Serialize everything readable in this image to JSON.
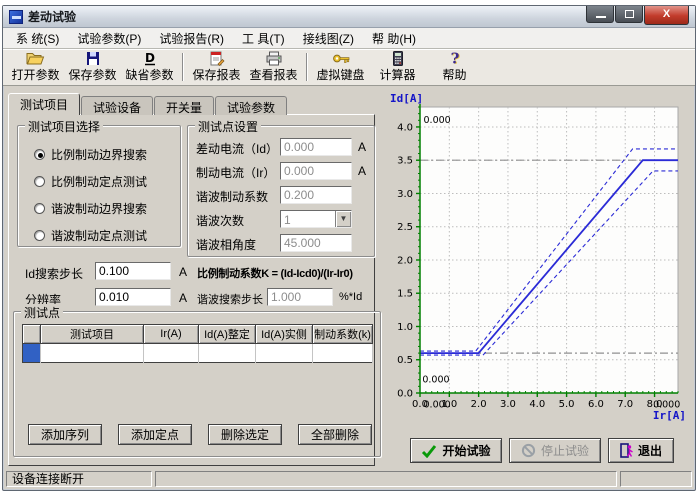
{
  "window": {
    "title": "差动试验",
    "controls": [
      {
        "name": "minimize-button",
        "icon": "minimize-icon"
      },
      {
        "name": "maximize-button",
        "icon": "maximize-icon"
      },
      {
        "name": "close-button",
        "icon": "close-icon"
      }
    ]
  },
  "menu": {
    "items": [
      {
        "label": "系 统(S)"
      },
      {
        "label": "试验参数(P)"
      },
      {
        "label": "试验报告(R)"
      },
      {
        "label": "工 具(T)"
      },
      {
        "label": "接线图(Z)"
      },
      {
        "label": "帮 助(H)"
      }
    ]
  },
  "toolbar": {
    "buttons": [
      {
        "label": "打开参数",
        "icon": "open-folder-icon"
      },
      {
        "label": "保存参数",
        "icon": "save-icon"
      },
      {
        "label": "缺省参数",
        "icon": "default-params-icon"
      },
      {
        "label": "保存报表",
        "icon": "save-report-icon"
      },
      {
        "label": "查看报表",
        "icon": "print-report-icon"
      },
      {
        "label": "虚拟键盘",
        "icon": "virtual-keyboard-icon"
      },
      {
        "label": "计算器",
        "icon": "calculator-icon"
      },
      {
        "label": "帮助",
        "icon": "help-icon"
      }
    ]
  },
  "tabs": [
    {
      "label": "测试项目",
      "active": true
    },
    {
      "label": "试验设备",
      "active": false
    },
    {
      "label": "开关量",
      "active": false
    },
    {
      "label": "试验参数",
      "active": false
    }
  ],
  "test_select": {
    "title": "测试项目选择",
    "options": [
      {
        "label": "比例制动边界搜索",
        "selected": true
      },
      {
        "label": "比例制动定点测试",
        "selected": false
      },
      {
        "label": "谐波制动边界搜索",
        "selected": false
      },
      {
        "label": "谐波制动定点测试",
        "selected": false
      }
    ]
  },
  "test_point_settings": {
    "title": "测试点设置",
    "fields": [
      {
        "label": "差动电流（Id）",
        "value": "0.000",
        "unit": "A",
        "disabled": true
      },
      {
        "label": "制动电流（Ir）",
        "value": "0.000",
        "unit": "A",
        "disabled": true
      },
      {
        "label": "谐波制动系数",
        "value": "0.200",
        "unit": "",
        "disabled": true
      },
      {
        "label": "谐波次数",
        "value": "1",
        "unit": "",
        "disabled": true
      },
      {
        "label": "谐波相角度",
        "value": "45.000",
        "unit": "",
        "disabled": true
      }
    ]
  },
  "search_settings": {
    "id_step": {
      "label": "Id搜索步长",
      "value": "0.100",
      "unit": "A",
      "disabled": false
    },
    "resolution": {
      "label": "分辨率",
      "value": "0.010",
      "unit": "A",
      "disabled": false
    },
    "formula": "比例制动系数K = (Id-Icd0)/(Ir-Ir0)",
    "harmonic_step": {
      "label": "谐波搜索步长",
      "value": "1.000",
      "unit": "%*Id",
      "disabled": true
    }
  },
  "test_points": {
    "title": "测试点",
    "columns": [
      "",
      "测试项目",
      "Ir(A)",
      "Id(A)整定",
      "Id(A)实侧",
      "制动系数(k)"
    ],
    "rows": [
      [
        "",
        "",
        "",
        "",
        "",
        ""
      ]
    ],
    "selection_color": "#3161c4",
    "buttons": [
      {
        "label": "添加序列"
      },
      {
        "label": "添加定点"
      },
      {
        "label": "删除选定"
      },
      {
        "label": "全部删除"
      }
    ]
  },
  "chart_data": {
    "type": "line",
    "xlabel": "Ir[A]",
    "ylabel": "Id[A]",
    "xlim": [
      0,
      8.8
    ],
    "ylim": [
      0,
      4.3
    ],
    "xticks": [
      0,
      1,
      2,
      3,
      4,
      5,
      6,
      7,
      8
    ],
    "yticks": [
      0,
      0.5,
      1,
      1.5,
      2,
      2.5,
      3,
      3.5,
      4
    ],
    "x_minor_step": 0.2,
    "y_minor_step": 0.1,
    "grid": true,
    "axis_color": "#008000",
    "label_color": "#1414c8",
    "series": [
      {
        "name": "boundary-curve",
        "color": "#2b2bd6",
        "width": 1.8,
        "dash": "",
        "points": [
          [
            0,
            0.6
          ],
          [
            2.0,
            0.6
          ],
          [
            7.6,
            3.5
          ],
          [
            8.8,
            3.5
          ]
        ]
      },
      {
        "name": "upper-tolerance",
        "color": "#2b2bd6",
        "width": 1.1,
        "dash": "4 3",
        "points": [
          [
            0,
            0.63
          ],
          [
            1.9,
            0.63
          ],
          [
            7.25,
            3.67
          ],
          [
            8.8,
            3.67
          ]
        ]
      },
      {
        "name": "lower-tolerance",
        "color": "#2b2bd6",
        "width": 1.1,
        "dash": "4 3",
        "points": [
          [
            0,
            0.57
          ],
          [
            2.15,
            0.57
          ],
          [
            7.95,
            3.34
          ],
          [
            8.8,
            3.34
          ]
        ]
      }
    ],
    "ref_lines": [
      {
        "y": 3.5,
        "color": "#909090"
      },
      {
        "y": 0.6,
        "color": "#909090"
      }
    ],
    "annotations": [
      {
        "x": 0.12,
        "y": 4.06,
        "text": "0.000"
      },
      {
        "x": 0.08,
        "y": 0.16,
        "text": "0.000"
      },
      {
        "x": 0.12,
        "y": -0.22,
        "text": "0.000"
      },
      {
        "x": 7.95,
        "y": -0.22,
        "text": "0.000"
      }
    ]
  },
  "actions": [
    {
      "label": "开始试验",
      "icon": "check-icon",
      "disabled": false
    },
    {
      "label": "停止试验",
      "icon": "stop-icon",
      "disabled": true
    },
    {
      "label": "退出",
      "icon": "exit-icon",
      "disabled": false
    }
  ],
  "status_bar": {
    "device_status": "设备连接断开"
  }
}
